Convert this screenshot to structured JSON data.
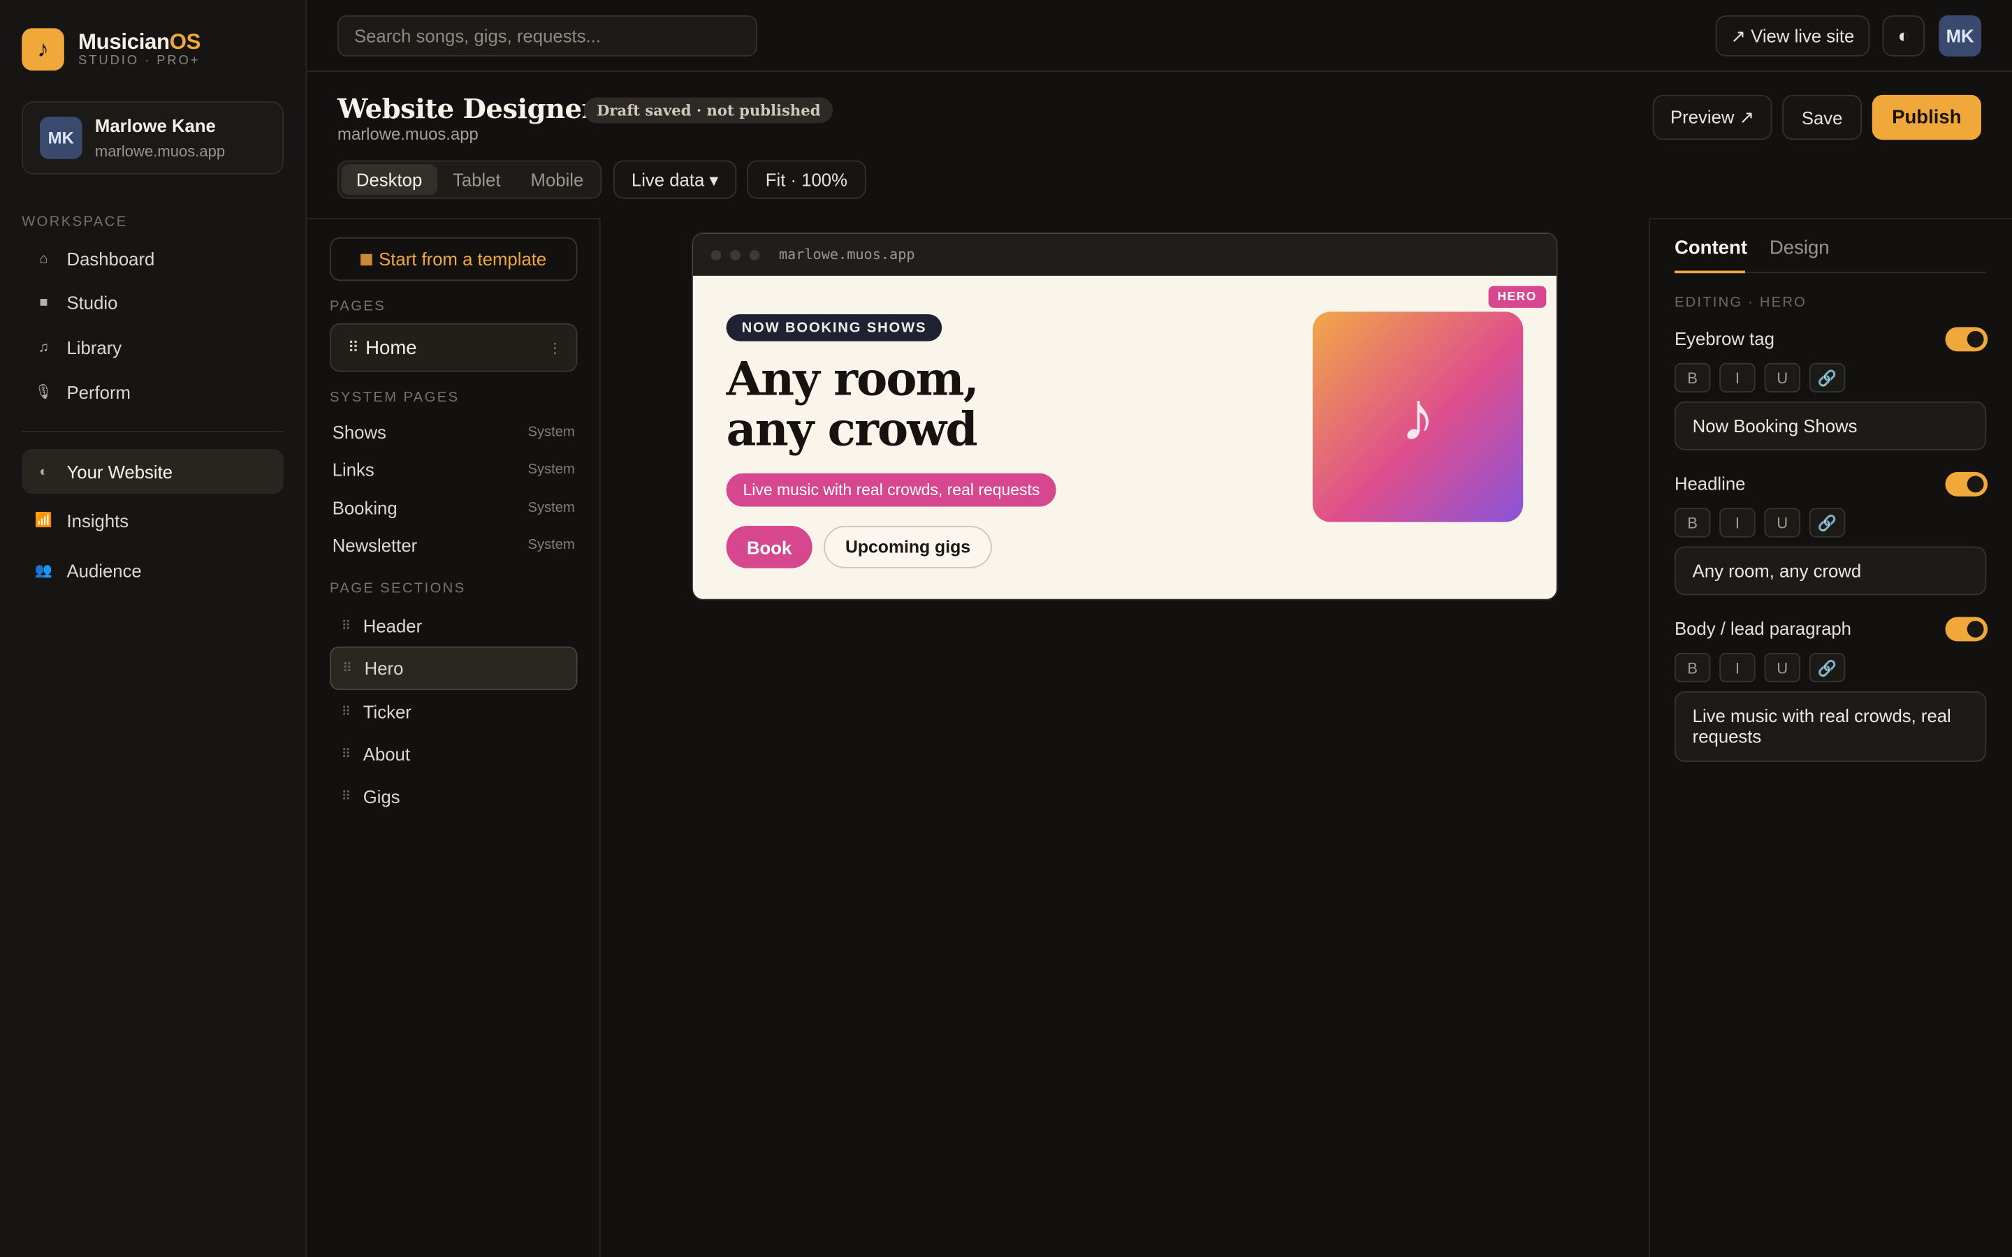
{
  "brand": {
    "logo_icon": "♪",
    "name_main": "Musician",
    "name_accent": "OS",
    "subtitle": "STUDIO · PRO+"
  },
  "profile": {
    "initials": "MK",
    "name": "Marlowe Kane",
    "domain": "marlowe.muos.app"
  },
  "sidebar": {
    "workspace_label": "WORKSPACE",
    "items": [
      {
        "label": "Dashboard",
        "icon": "⌂"
      },
      {
        "label": "Studio",
        "icon": "■"
      },
      {
        "label": "Library",
        "icon": "♫"
      },
      {
        "label": "Perform",
        "icon": "🎙"
      }
    ],
    "items2": [
      {
        "label": "Your Website",
        "icon": "◐",
        "active": true
      },
      {
        "label": "Insights",
        "icon": "📶"
      },
      {
        "label": "Audience",
        "icon": "👥"
      }
    ]
  },
  "topbar": {
    "search_placeholder": "Search songs, gigs, requests...",
    "view_live": "↗ View live site",
    "theme_icon": "◐",
    "user_initials": "MK"
  },
  "header": {
    "title": "Website Designer",
    "status": "Draft saved · not published",
    "domain": "marlowe.muos.app",
    "preview": "Preview ↗",
    "save": "Save",
    "publish": "Publish"
  },
  "toolbar": {
    "devices": [
      "Desktop",
      "Tablet",
      "Mobile"
    ],
    "active_device": "Desktop",
    "data_mode": "Live data ▾",
    "zoom": "Fit · 100%"
  },
  "pages_panel": {
    "template_button": "Start from a template",
    "pages_label": "PAGES",
    "home": "Home",
    "system_label": "SYSTEM PAGES",
    "system_pages": [
      {
        "name": "Shows",
        "tag": "System"
      },
      {
        "name": "Links",
        "tag": "System"
      },
      {
        "name": "Booking",
        "tag": "System"
      },
      {
        "name": "Newsletter",
        "tag": "System"
      }
    ],
    "sections_label": "PAGE SECTIONS",
    "sections": [
      "Header",
      "Hero",
      "Ticker",
      "About",
      "Gigs"
    ],
    "active_section": "Hero"
  },
  "preview": {
    "url": "marlowe.muos.app",
    "hero_badge": "HERO",
    "eyebrow": "NOW BOOKING SHOWS",
    "headline_line1": "Any room,",
    "headline_line2": "any crowd",
    "lead": "Live music with real crowds, real requests",
    "book": "Book",
    "upcoming": "Upcoming gigs",
    "art_icon": "♪"
  },
  "inspector": {
    "tabs": [
      "Content",
      "Design"
    ],
    "active_tab": "Content",
    "editing": "EDITING · HERO",
    "fields": [
      {
        "label": "Eyebrow tag",
        "value": "Now Booking Shows",
        "enabled": true
      },
      {
        "label": "Headline",
        "value": "Any room, any crowd",
        "enabled": true
      },
      {
        "label": "Body / lead paragraph",
        "value": "Live music with real crowds, real requests",
        "enabled": true
      }
    ],
    "format_buttons": [
      "B",
      "I",
      "U",
      "🔗"
    ]
  },
  "colors": {
    "accent": "#f0a83a",
    "pink": "#d6478f",
    "bg": "#121110"
  }
}
